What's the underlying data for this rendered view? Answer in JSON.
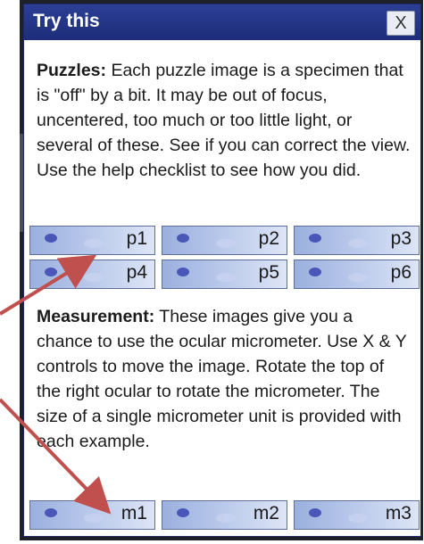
{
  "window": {
    "title": "Try this",
    "close_label": "X"
  },
  "puzzles": {
    "heading": "Puzzles:",
    "text": " Each puzzle image is a specimen that is \"off\" by a bit. It may be out of focus, uncentered, too much or too little light, or several of these. See if you can correct the view. Use the help checklist  to see how you did.",
    "thumbs": [
      "p1",
      "p2",
      "p3",
      "p4",
      "p5",
      "p6"
    ]
  },
  "measurement": {
    "heading": "Measurement:",
    "text": " These images give you a chance to use the ocular micrometer. Use X & Y controls to move the image. Rotate the top of the right ocular to rotate the micrometer. The size of a single micrometer unit is provided with each example.",
    "thumbs": [
      "m1",
      "m2",
      "m3"
    ]
  },
  "colors": {
    "titlebar": "#1d2d7a",
    "arrow": "#c0504d",
    "thumb_fill": "#b7c7ea"
  }
}
